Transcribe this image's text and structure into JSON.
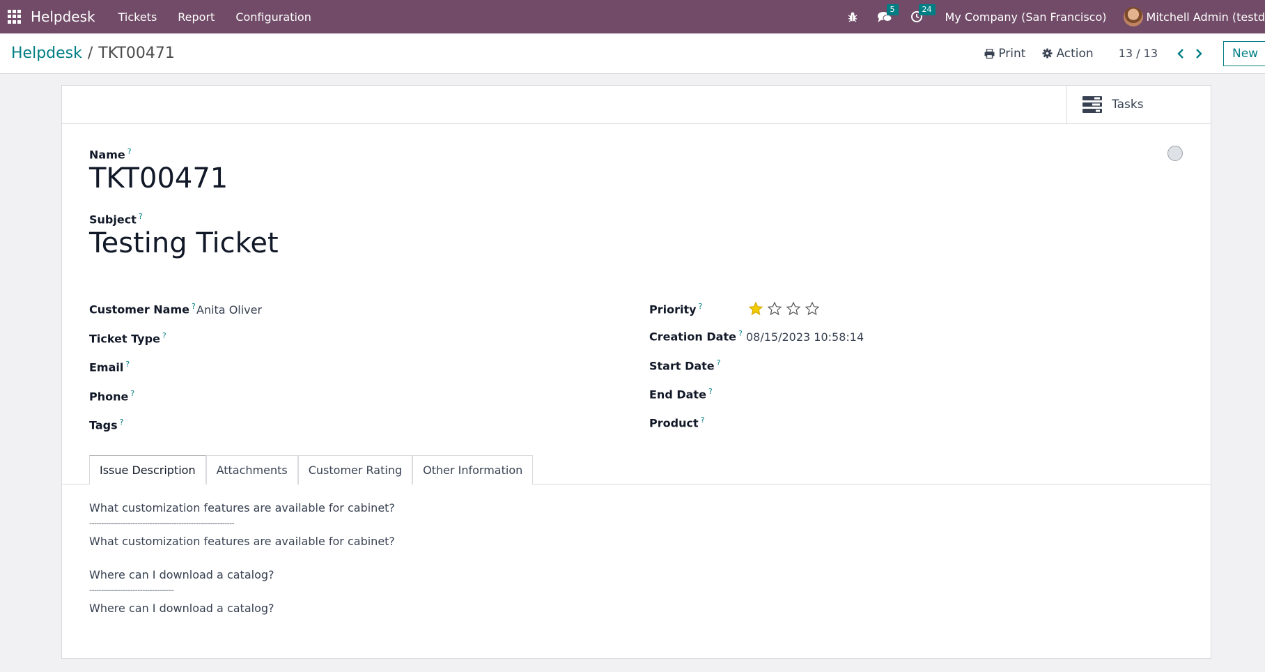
{
  "navbar": {
    "brand": "Helpdesk",
    "menu": [
      "Tickets",
      "Report",
      "Configuration"
    ],
    "chat_count": "5",
    "activity_count": "24",
    "company": "My Company (San Francisco)",
    "user": "Mitchell Admin (testd"
  },
  "control_panel": {
    "breadcrumb_parent": "Helpdesk",
    "breadcrumb_current": "TKT00471",
    "print_label": "Print",
    "action_label": "Action",
    "pager": "13 / 13",
    "new_label": "New"
  },
  "button_box": {
    "tasks_label": "Tasks"
  },
  "form": {
    "name_label": "Name",
    "name_value": "TKT00471",
    "subject_label": "Subject",
    "subject_value": "Testing Ticket",
    "left_fields": [
      {
        "label": "Customer Name",
        "value": "Anita Oliver"
      },
      {
        "label": "Ticket Type",
        "value": ""
      },
      {
        "label": "Email",
        "value": ""
      },
      {
        "label": "Phone",
        "value": ""
      },
      {
        "label": "Tags",
        "value": ""
      }
    ],
    "right_fields": [
      {
        "label": "Priority",
        "value": ""
      },
      {
        "label": "Creation Date",
        "value": "08/15/2023 10:58:14"
      },
      {
        "label": "Start Date",
        "value": ""
      },
      {
        "label": "End Date",
        "value": ""
      },
      {
        "label": "Product",
        "value": ""
      }
    ],
    "priority_stars": 1,
    "priority_max": 4,
    "help_mark": "?"
  },
  "tabs": [
    "Issue Description",
    "Attachments",
    "Customer Rating",
    "Other Information"
  ],
  "description": {
    "line1": "What customization features are available for cabinet?",
    "sep1": "------------------------------------------------------------",
    "line2": "What customization features are available for cabinet?",
    "line3": "Where can I download a catalog?",
    "sep2": "-----------------------------------",
    "line4": "Where can I download a catalog?"
  },
  "colors": {
    "navbar": "#714b67",
    "accent": "#017e84",
    "star_filled": "#f3cc00"
  }
}
